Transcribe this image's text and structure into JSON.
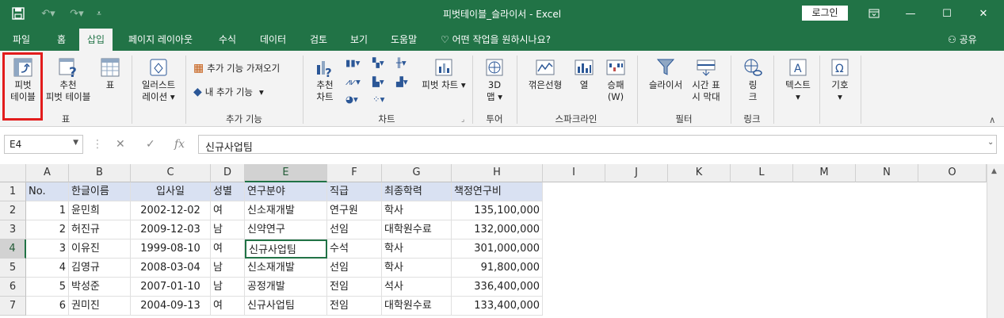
{
  "titlebar": {
    "title": "피벗테이블_슬라이서  -  Excel",
    "login": "로그인"
  },
  "tabs": [
    "파일",
    "홈",
    "삽입",
    "페이지 레이아웃",
    "수식",
    "데이터",
    "검토",
    "보기",
    "도움말"
  ],
  "tellme": "어떤 작업을 원하시나요?",
  "share": "공유",
  "ribbon": {
    "pivot": [
      "피벗",
      "테이블"
    ],
    "recommended_pivot": [
      "추천",
      "피벗 테이블"
    ],
    "table": "표",
    "illustrations": [
      "일러스트",
      "레이션"
    ],
    "get_addins": "추가 기능 가져오기",
    "my_addins": "내 추가 기능",
    "recommended_charts": [
      "추천",
      "차트"
    ],
    "pivot_chart": "피벗 차트",
    "map3d": [
      "3D",
      "맵"
    ],
    "line": "꺾은선형",
    "column": "열",
    "winloss": [
      "승패",
      "(W)"
    ],
    "slicer": "슬라이서",
    "timeline": [
      "시간 표",
      "시 막대"
    ],
    "link": [
      "링",
      "크"
    ],
    "text": "텍스트",
    "symbol": "기호",
    "groups": {
      "table": "표",
      "addins": "추가 기능",
      "charts": "차트",
      "tours": "투어",
      "sparklines": "스파크라인",
      "filters": "필터",
      "links": "링크"
    }
  },
  "formula": {
    "namebox": "E4",
    "fx": "fx",
    "content": "신규사업팀"
  },
  "columns": [
    "A",
    "B",
    "C",
    "D",
    "E",
    "F",
    "G",
    "H",
    "I",
    "J",
    "K",
    "L",
    "M",
    "N",
    "O"
  ],
  "rows": [
    "1",
    "2",
    "3",
    "4",
    "5",
    "6",
    "7"
  ],
  "sheet": {
    "header": [
      "No.",
      "한글이름",
      "입사일",
      "성별",
      "연구분야",
      "직급",
      "최종학력",
      "책정연구비"
    ],
    "data": [
      [
        "1",
        "윤민희",
        "2002-12-02",
        "여",
        "신소재개발",
        "연구원",
        "학사",
        "135,100,000"
      ],
      [
        "2",
        "허진규",
        "2009-12-03",
        "남",
        "신약연구",
        "선임",
        "대학원수료",
        "132,000,000"
      ],
      [
        "3",
        "이유진",
        "1999-08-10",
        "여",
        "신규사업팀",
        "수석",
        "학사",
        "301,000,000"
      ],
      [
        "4",
        "김영규",
        "2008-03-04",
        "남",
        "신소재개발",
        "선임",
        "학사",
        "91,800,000"
      ],
      [
        "5",
        "박성준",
        "2007-01-10",
        "남",
        "공정개발",
        "전임",
        "석사",
        "336,400,000"
      ],
      [
        "6",
        "권미진",
        "2004-09-13",
        "여",
        "신규사업팀",
        "전임",
        "대학원수료",
        "133,400,000"
      ]
    ]
  },
  "colors": {
    "accent": "#217346",
    "header_fill": "#d9e1f2",
    "highlight": "#e21c1c"
  }
}
